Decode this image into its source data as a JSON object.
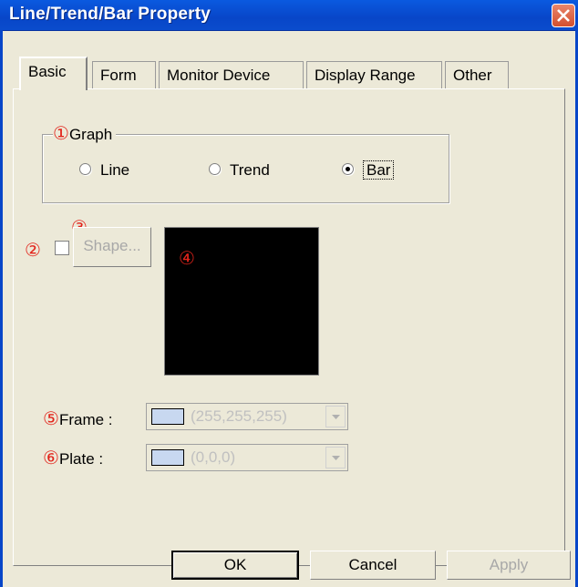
{
  "window": {
    "title": "Line/Trend/Bar Property"
  },
  "tabs": [
    {
      "label": "Basic"
    },
    {
      "label": "Form"
    },
    {
      "label": "Monitor Device"
    },
    {
      "label": "Display Range"
    },
    {
      "label": "Other"
    }
  ],
  "graph": {
    "marker": "①",
    "legend": "Graph",
    "options": [
      {
        "label": "Line",
        "selected": false
      },
      {
        "label": "Trend",
        "selected": false
      },
      {
        "label": "Bar",
        "selected": true
      }
    ]
  },
  "shape": {
    "checkbox_marker": "②",
    "button_marker": "③",
    "button_label": "Shape...",
    "checked": false
  },
  "preview": {
    "marker": "④",
    "color": "#000000"
  },
  "frame": {
    "marker": "⑤",
    "label": "Frame :",
    "value": "(255,255,255)"
  },
  "plate": {
    "marker": "⑥",
    "label": "Plate :",
    "value": "(0,0,0)"
  },
  "buttons": {
    "ok": "OK",
    "cancel": "Cancel",
    "apply": "Apply"
  }
}
